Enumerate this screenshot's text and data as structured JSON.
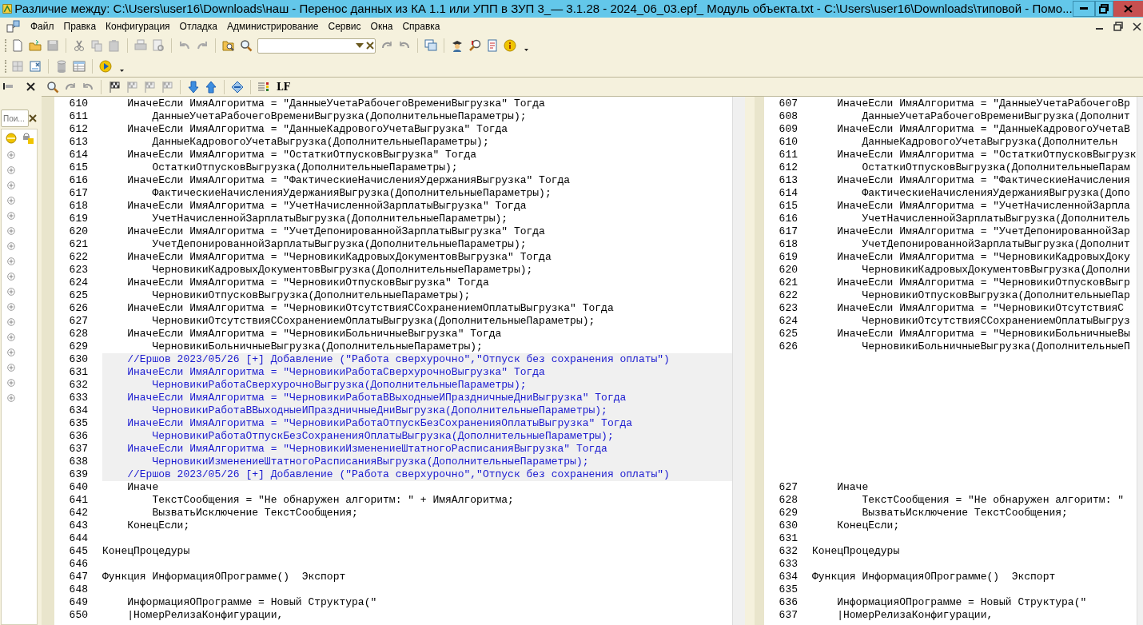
{
  "window": {
    "title": "Различие между: C:\\Users\\user16\\Downloads\\наш - Перенос данных из КА 1.1 или УПП в ЗУП 3_— 3.1.28 - 2024_06_03.epf_ Модуль объекта.txt - C:\\Users\\user16\\Downloads\\типовой - Помо..."
  },
  "menu": [
    "Файл",
    "Правка",
    "Конфигурация",
    "Отладка",
    "Администрирование",
    "Сервис",
    "Окна",
    "Справка"
  ],
  "side_panel": {
    "search": {
      "placeholder": "Пои..."
    }
  },
  "diff_toolbar": {
    "line_ending": "LF"
  },
  "left_pane": {
    "lines": [
      {
        "number": "610",
        "kind": "normal",
        "text": "    ИначеЕсли ИмяАлгоритма = \"ДанныеУчетаРабочегоВремениВыгрузка\" Тогда"
      },
      {
        "number": "611",
        "kind": "normal",
        "text": "        ДанныеУчетаРабочегоВремениВыгрузка(ДополнительныеПараметры);"
      },
      {
        "number": "612",
        "kind": "normal",
        "text": "    ИначеЕсли ИмяАлгоритма = \"ДанныеКадровогоУчетаВыгрузка\" Тогда"
      },
      {
        "number": "613",
        "kind": "normal",
        "text": "        ДанныеКадровогоУчетаВыгрузка(ДополнительныеПараметры);"
      },
      {
        "number": "614",
        "kind": "normal",
        "text": "    ИначеЕсли ИмяАлгоритма = \"ОстаткиОтпусковВыгрузка\" Тогда"
      },
      {
        "number": "615",
        "kind": "normal",
        "text": "        ОстаткиОтпусковВыгрузка(ДополнительныеПараметры);"
      },
      {
        "number": "616",
        "kind": "normal",
        "text": "    ИначеЕсли ИмяАлгоритма = \"ФактическиеНачисленияУдержанияВыгрузка\" Тогда"
      },
      {
        "number": "617",
        "kind": "normal",
        "text": "        ФактическиеНачисленияУдержанияВыгрузка(ДополнительныеПараметры);"
      },
      {
        "number": "618",
        "kind": "normal",
        "text": "    ИначеЕсли ИмяАлгоритма = \"УчетНачисленнойЗарплатыВыгрузка\" Тогда"
      },
      {
        "number": "619",
        "kind": "normal",
        "text": "        УчетНачисленнойЗарплатыВыгрузка(ДополнительныеПараметры);"
      },
      {
        "number": "620",
        "kind": "normal",
        "text": "    ИначеЕсли ИмяАлгоритма = \"УчетДепонированнойЗарплатыВыгрузка\" Тогда"
      },
      {
        "number": "621",
        "kind": "normal",
        "text": "        УчетДепонированнойЗарплатыВыгрузка(ДополнительныеПараметры);"
      },
      {
        "number": "622",
        "kind": "normal",
        "text": "    ИначеЕсли ИмяАлгоритма = \"ЧерновикиКадровыхДокументовВыгрузка\" Тогда"
      },
      {
        "number": "623",
        "kind": "normal",
        "text": "        ЧерновикиКадровыхДокументовВыгрузка(ДополнительныеПараметры);"
      },
      {
        "number": "624",
        "kind": "normal",
        "text": "    ИначеЕсли ИмяАлгоритма = \"ЧерновикиОтпусковВыгрузка\" Тогда"
      },
      {
        "number": "625",
        "kind": "normal",
        "text": "        ЧерновикиОтпусковВыгрузка(ДополнительныеПараметры);"
      },
      {
        "number": "626",
        "kind": "normal",
        "text": "    ИначеЕсли ИмяАлгоритма = \"ЧерновикиОтсутствияССохранениемОплатыВыгрузка\" Тогда"
      },
      {
        "number": "627",
        "kind": "normal",
        "text": "        ЧерновикиОтсутствияССохранениемОплатыВыгрузка(ДополнительныеПараметры);"
      },
      {
        "number": "628",
        "kind": "normal",
        "text": "    ИначеЕсли ИмяАлгоритма = \"ЧерновикиБольничныеВыгрузка\" Тогда"
      },
      {
        "number": "629",
        "kind": "normal",
        "text": "        ЧерновикиБольничныеВыгрузка(ДополнительныеПараметры);"
      },
      {
        "number": "630",
        "kind": "added",
        "text": "    //Ершов 2023/05/26 [+] Добавление (\"Работа сверхурочно\",\"Отпуск без сохранения оплаты\")"
      },
      {
        "number": "631",
        "kind": "added",
        "text": "    ИначеЕсли ИмяАлгоритма = \"ЧерновикиРаботаСверхурочноВыгрузка\" Тогда"
      },
      {
        "number": "632",
        "kind": "added",
        "text": "        ЧерновикиРаботаСверхурочноВыгрузка(ДополнительныеПараметры);"
      },
      {
        "number": "633",
        "kind": "added",
        "text": "    ИначеЕсли ИмяАлгоритма = \"ЧерновикиРаботаВВыходныеИПраздничныеДниВыгрузка\" Тогда"
      },
      {
        "number": "634",
        "kind": "added",
        "text": "        ЧерновикиРаботаВВыходныеИПраздничныеДниВыгрузка(ДополнительныеПараметры);"
      },
      {
        "number": "635",
        "kind": "added",
        "text": "    ИначеЕсли ИмяАлгоритма = \"ЧерновикиРаботаОтпускБезСохраненияОплатыВыгрузка\" Тогда"
      },
      {
        "number": "636",
        "kind": "added",
        "text": "        ЧерновикиРаботаОтпускБезСохраненияОплатыВыгрузка(ДополнительныеПараметры);"
      },
      {
        "number": "637",
        "kind": "added",
        "text": "    ИначеЕсли ИмяАлгоритма = \"ЧерновикиИзменениеШтатногоРасписанияВыгрузка\" Тогда"
      },
      {
        "number": "638",
        "kind": "added",
        "text": "        ЧерновикиИзменениеШтатногоРасписанияВыгрузка(ДополнительныеПараметры);"
      },
      {
        "number": "639",
        "kind": "added",
        "text": "    //Ершов 2023/05/26 [+] Добавление (\"Работа сверхурочно\",\"Отпуск без сохранения оплаты\")"
      },
      {
        "number": "640",
        "kind": "normal",
        "text": "    Иначе"
      },
      {
        "number": "641",
        "kind": "normal",
        "text": "        ТекстСообщения = \"Не обнаружен алгоритм: \" + ИмяАлгоритма;"
      },
      {
        "number": "642",
        "kind": "normal",
        "text": "        ВызватьИсключение ТекстСообщения;"
      },
      {
        "number": "643",
        "kind": "normal",
        "text": "    КонецЕсли;"
      },
      {
        "number": "644",
        "kind": "normal"
      },
      {
        "number": "645",
        "kind": "normal",
        "text": "КонецПроцедуры"
      },
      {
        "number": "646",
        "kind": "normal"
      },
      {
        "number": "647",
        "kind": "normal",
        "text": "Функция ИнформацияОПрограмме()  Экспорт"
      },
      {
        "number": "648",
        "kind": "normal"
      },
      {
        "number": "649",
        "kind": "normal",
        "text": "    ИнформацияОПрограмме = Новый Структура(\""
      },
      {
        "number": "650",
        "kind": "normal",
        "text": "    |НомерРелизаКонфигурации,"
      }
    ]
  },
  "right_pane": {
    "lines": [
      {
        "number": "607",
        "kind": "normal",
        "text": "    ИначеЕсли ИмяАлгоритма = \"ДанныеУчетаРабочегоВр"
      },
      {
        "number": "608",
        "kind": "normal",
        "text": "        ДанныеУчетаРабочегоВремениВыгрузка(Дополнит"
      },
      {
        "number": "609",
        "kind": "normal",
        "text": "    ИначеЕсли ИмяАлгоритма = \"ДанныеКадровогоУчетаВ"
      },
      {
        "number": "610",
        "kind": "normal",
        "text": "        ДанныеКадровогоУчетаВыгрузка(Дополнительн"
      },
      {
        "number": "611",
        "kind": "normal",
        "text": "    ИначеЕсли ИмяАлгоритма = \"ОстаткиОтпусковВыгрузк"
      },
      {
        "number": "612",
        "kind": "normal",
        "text": "        ОстаткиОтпусковВыгрузка(ДополнительныеПарам"
      },
      {
        "number": "613",
        "kind": "normal",
        "text": "    ИначеЕсли ИмяАлгоритма = \"ФактическиеНачисления"
      },
      {
        "number": "614",
        "kind": "normal",
        "text": "        ФактическиеНачисленияУдержанияВыгрузка(Допо"
      },
      {
        "number": "615",
        "kind": "normal",
        "text": "    ИначеЕсли ИмяАлгоритма = \"УчетНачисленнойЗарпла"
      },
      {
        "number": "616",
        "kind": "normal",
        "text": "        УчетНачисленнойЗарплатыВыгрузка(Дополнитель"
      },
      {
        "number": "617",
        "kind": "normal",
        "text": "    ИначеЕсли ИмяАлгоритма = \"УчетДепонированнойЗар"
      },
      {
        "number": "618",
        "kind": "normal",
        "text": "        УчетДепонированнойЗарплатыВыгрузка(Дополнит"
      },
      {
        "number": "619",
        "kind": "normal",
        "text": "    ИначеЕсли ИмяАлгоритма = \"ЧерновикиКадровыхДоку"
      },
      {
        "number": "620",
        "kind": "normal",
        "text": "        ЧерновикиКадровыхДокументовВыгрузка(Дополни"
      },
      {
        "number": "621",
        "kind": "normal",
        "text": "    ИначеЕсли ИмяАлгоритма = \"ЧерновикиОтпусковВыгр"
      },
      {
        "number": "622",
        "kind": "normal",
        "text": "        ЧерновикиОтпусковВыгрузка(ДополнительныеПар"
      },
      {
        "number": "623",
        "kind": "normal",
        "text": "    ИначеЕсли ИмяАлгоритма = \"ЧерновикиОтсутствияС"
      },
      {
        "number": "624",
        "kind": "normal",
        "text": "        ЧерновикиОтсутствияССохранениемОплатыВыгруз"
      },
      {
        "number": "625",
        "kind": "normal",
        "text": "    ИначеЕсли ИмяАлгоритма = \"ЧерновикиБольничныеВы"
      },
      {
        "number": "626",
        "kind": "normal",
        "text": "        ЧерновикиБольничныеВыгрузка(ДополнительныеП"
      },
      {
        "kind": "gap"
      },
      {
        "kind": "gap"
      },
      {
        "kind": "gap"
      },
      {
        "kind": "gap"
      },
      {
        "kind": "gap"
      },
      {
        "kind": "gap"
      },
      {
        "kind": "gap"
      },
      {
        "kind": "gap"
      },
      {
        "kind": "gap"
      },
      {
        "kind": "gap"
      },
      {
        "number": "627",
        "kind": "normal",
        "text": "    Иначе"
      },
      {
        "number": "628",
        "kind": "normal",
        "text": "        ТекстСообщения = \"Не обнаружен алгоритм: \""
      },
      {
        "number": "629",
        "kind": "normal",
        "text": "        ВызватьИсключение ТекстСообщения;"
      },
      {
        "number": "630",
        "kind": "normal",
        "text": "    КонецЕсли;"
      },
      {
        "number": "631",
        "kind": "normal"
      },
      {
        "number": "632",
        "kind": "normal",
        "text": "КонецПроцедуры"
      },
      {
        "number": "633",
        "kind": "normal"
      },
      {
        "number": "634",
        "kind": "normal",
        "text": "Функция ИнформацияОПрограмме()  Экспорт"
      },
      {
        "number": "635",
        "kind": "normal"
      },
      {
        "number": "636",
        "kind": "normal",
        "text": "    ИнформацияОПрограмме = Новый Структура(\""
      },
      {
        "number": "637",
        "kind": "normal",
        "text": "    |НомерРелизаКонфигурации,"
      }
    ]
  }
}
